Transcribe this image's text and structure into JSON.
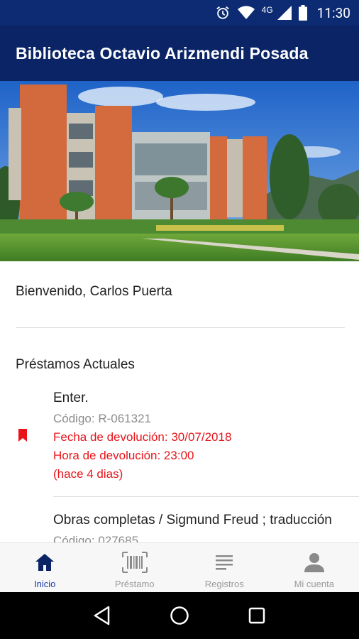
{
  "status_bar": {
    "time": "11:30",
    "network": "4G",
    "icons": [
      "alarm-icon",
      "wifi-icon",
      "signal-icon",
      "battery-icon"
    ]
  },
  "app_bar": {
    "title": "Biblioteca Octavio Arizmendi Posada"
  },
  "hero": {
    "image": "library-building-photo"
  },
  "main": {
    "welcome": "Bienvenido, Carlos Puerta",
    "section_title": "Préstamos Actuales",
    "loans": [
      {
        "title": "Enter.",
        "code": "Código: R-061321",
        "due_date": "Fecha de devolución: 30/07/2018",
        "due_time": "Hora de devolución: 23:00",
        "overdue": "(hace 4 dias)",
        "icon": "bookmark-icon"
      },
      {
        "title": "Obras completas / Sigmund Freud ; traducción",
        "code": "Código: 027685"
      }
    ]
  },
  "bottom_nav": {
    "items": [
      {
        "label": "Inicio",
        "icon": "home-icon",
        "active": true
      },
      {
        "label": "Préstamo",
        "icon": "barcode-icon",
        "active": false
      },
      {
        "label": "Registros",
        "icon": "list-icon",
        "active": false
      },
      {
        "label": "Mi cuenta",
        "icon": "person-icon",
        "active": false
      }
    ]
  },
  "colors": {
    "primary": "#0a2466",
    "accent": "#1a3aa8",
    "overdue": "#e8141a",
    "muted": "#8c8c8c"
  }
}
